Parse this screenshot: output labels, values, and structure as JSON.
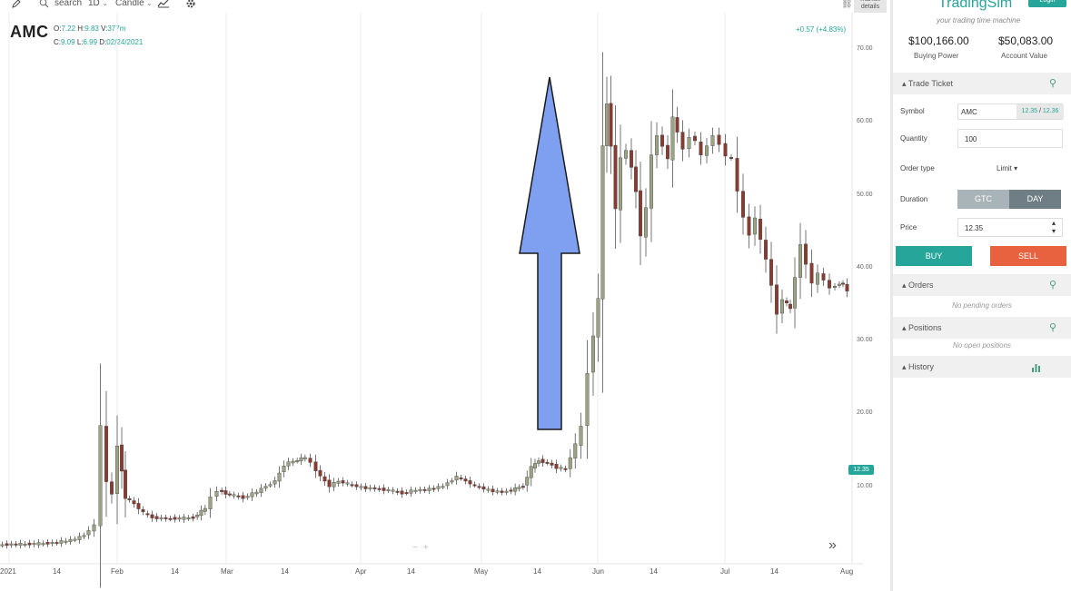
{
  "toolbar": {
    "search_label": "search",
    "interval": "1D",
    "chart_type": "Candle",
    "market_details": "market details"
  },
  "chart": {
    "symbol": "AMC",
    "ohlc": {
      "open_label": "O:",
      "open": "7.22",
      "high_label": "H:",
      "high": "9.83",
      "volume_label": "V:",
      "volume": "377m",
      "close_label": "C:",
      "close": "9.09",
      "low_label": "L:",
      "low": "6.99",
      "date_label": "D:",
      "date": "02/24/2021"
    },
    "change": "+0.57 (+4.83%)",
    "last_price": "12.35",
    "price_axis": [
      "70.00",
      "60.00",
      "50.00",
      "40.00",
      "30.00",
      "20.00",
      "10.00"
    ],
    "date_axis": [
      "2021",
      "14",
      "Feb",
      "14",
      "Mar",
      "14",
      "Apr",
      "14",
      "May",
      "14",
      "Jun",
      "14",
      "Jul",
      "14",
      "Aug"
    ],
    "zoom_minus": "−",
    "zoom_plus": "+",
    "scroll_right": "»",
    "colors": {
      "up": "#9aa383",
      "down": "#8b3a2f",
      "accent": "#26a69a",
      "arrow": "#7f9ff0"
    }
  },
  "panel": {
    "logo": "TradingSim",
    "tagline": "your trading time machine",
    "login": "Login",
    "buying_power": "$100,166.00",
    "buying_power_label": "Buying Power",
    "account_value": "$50,083.00",
    "account_value_label": "Account Value",
    "trade_ticket": {
      "title": "Trade Ticket",
      "symbol_label": "Symbol",
      "symbol_value": "AMC",
      "bid": "12.35",
      "ask": "12.36",
      "quantity_label": "Quantity",
      "quantity_value": "100",
      "order_type_label": "Order type",
      "order_type_value": "Limit",
      "duration_label": "Duration",
      "duration_gtc": "GTC",
      "duration_day": "DAY",
      "price_label": "Price",
      "price_value": "12.35",
      "buy_label": "BUY",
      "sell_label": "SELL"
    },
    "orders": {
      "title": "Orders",
      "empty": "No pending orders"
    },
    "positions": {
      "title": "Positions",
      "empty": "No open positions"
    },
    "history": {
      "title": "History"
    },
    "colors": {
      "buy": "#26a69a",
      "sell": "#e8623f",
      "segment_inactive": "#a9b4b9",
      "segment_active": "#6f7d84"
    }
  }
}
